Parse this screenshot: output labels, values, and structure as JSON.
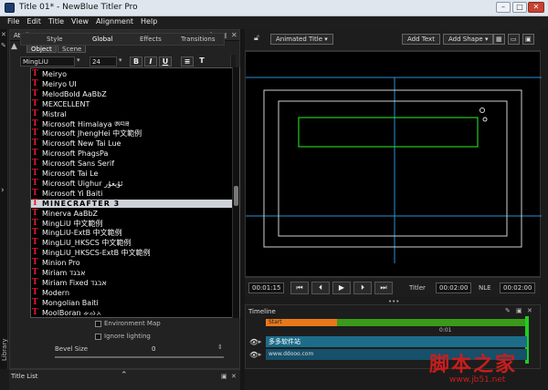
{
  "window": {
    "title": "Title 01* - NewBlue Titler Pro"
  },
  "menu": [
    "File",
    "Edit",
    "Title",
    "View",
    "Alignment",
    "Help"
  ],
  "side": {
    "library_label": "Library",
    "expand_arrow": "›"
  },
  "attributes": {
    "header": "Attributes",
    "tabs": [
      "Object",
      "Scene"
    ],
    "subtabs": [
      "Style",
      "Global",
      "Effects",
      "Transitions"
    ],
    "font_value": "MingLiU",
    "size_value": "24",
    "bold": "B",
    "italic": "I",
    "underline": "U",
    "align_icon": "≡",
    "text_icon": "T"
  },
  "font_list": [
    {
      "icon": "T",
      "name": "Meiryo"
    },
    {
      "icon": "T",
      "name": "Meiryo UI"
    },
    {
      "icon": "T",
      "name": "MelodBold  AaBbZ"
    },
    {
      "icon": "T",
      "name": "MEXCELLENT"
    },
    {
      "icon": "T",
      "name": "Mistral"
    },
    {
      "icon": "T",
      "name": "Microsoft Himalaya ཨབཟ"
    },
    {
      "icon": "T",
      "name": "Microsoft JhengHei  中文範例"
    },
    {
      "icon": "T",
      "name": "Microsoft New Tai Lue"
    },
    {
      "icon": "T",
      "name": "Microsoft PhagsPa"
    },
    {
      "icon": "T",
      "name": "Microsoft Sans Serif"
    },
    {
      "icon": "T",
      "name": "Microsoft Tai Le"
    },
    {
      "icon": "T",
      "name": "Microsoft Uighur ئۇيغۇر"
    },
    {
      "icon": "T",
      "name": "Microsoft Yi Baiti"
    },
    {
      "icon": "T",
      "name": "MINECRAFTER 3"
    },
    {
      "icon": "T",
      "name": "Minerva  AaBbZ"
    },
    {
      "icon": "T",
      "name": "MingLiU  中文範例"
    },
    {
      "icon": "T",
      "name": "MingLiU-ExtB  中文範例"
    },
    {
      "icon": "T",
      "name": "MingLiU_HKSCS  中文範例"
    },
    {
      "icon": "T",
      "name": "MingLiU_HKSCS-ExtB  中文範例"
    },
    {
      "icon": "T",
      "name": "Minion Pro"
    },
    {
      "icon": "T",
      "name": "Miriam  אבגד"
    },
    {
      "icon": "T",
      "name": "Miriam Fixed  אבגד"
    },
    {
      "icon": "T",
      "name": "Modern"
    },
    {
      "icon": "T",
      "name": "Mongolian Baiti"
    },
    {
      "icon": "T",
      "name": "MoolBoran ᨀᨁᨂ"
    }
  ],
  "font_list_selected": "MINECRAFTER 3",
  "options": {
    "environment_map": "Environment Map",
    "ignore_lighting": "Ignore lighting",
    "bevel_size_label": "Bevel Size",
    "bevel_size_value": "0"
  },
  "preview": {
    "animation_select": "Animated Title",
    "add_text": "Add Text",
    "add_shape": "Add Shape"
  },
  "transport": {
    "time_current": "00:01:15",
    "titler_label": "Titler",
    "titler_time": "00:02:00",
    "nle_label": "NLE",
    "nle_time": "00:02:00"
  },
  "timeline": {
    "header": "Timeline",
    "start_label": "Start",
    "marker_time": "0:01",
    "track1_text": "多多软件站",
    "track2_text": "www.ddooo.com"
  },
  "title_list": {
    "header": "Title List"
  },
  "watermark": {
    "cn": "脚本之家",
    "url": "www.jb51.net"
  },
  "colors": {
    "accent_red": "#e4182a",
    "timeline_bar": "#1d6d8a",
    "start_orange": "#e8781a",
    "green_box": "#22cc22",
    "guide_blue": "#2d8fd8"
  }
}
